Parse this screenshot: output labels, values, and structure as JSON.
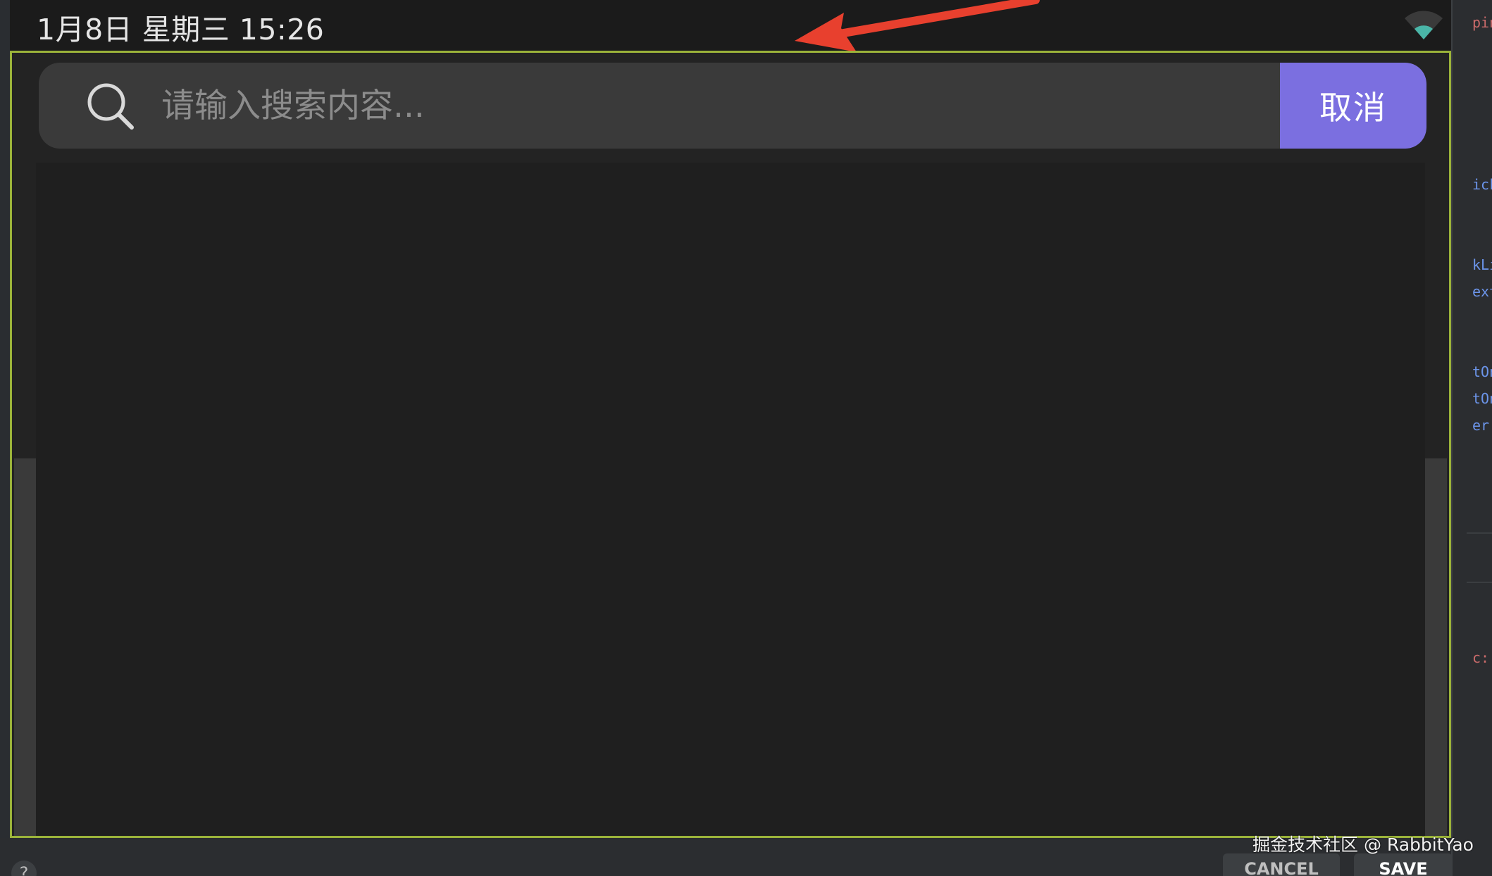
{
  "status_bar": {
    "datetime": "1月8日 星期三 15:26"
  },
  "search": {
    "placeholder": "请输入搜索内容...",
    "value": "",
    "cancel_label": "取消"
  },
  "colors": {
    "accent": "#7b6fe0",
    "frame_highlight": "#9bb33a",
    "annotation_arrow": "#e8402e",
    "wifi": "#4ab6a8"
  },
  "ide": {
    "code_fragments": [
      "pin",
      "ick",
      "kLi",
      "ext",
      "tOn",
      "tOn",
      "er",
      "c:"
    ],
    "help_label": "?",
    "cancel_label": "CANCEL",
    "save_label": "SAVE"
  },
  "watermark": "掘金技术社区 @ RabbitYao"
}
